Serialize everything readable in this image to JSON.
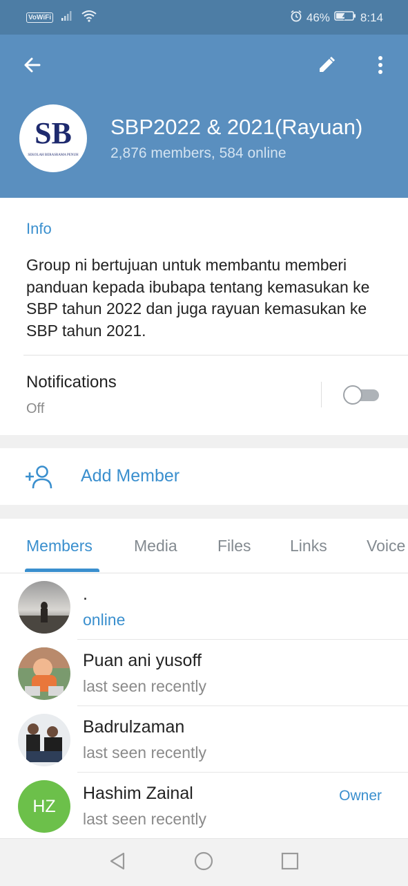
{
  "status_bar": {
    "vowifi": "VoWiFi",
    "battery": "46%",
    "time": "8:14"
  },
  "header": {
    "title": "SBP2022 & 2021(Rayuan)",
    "subtitle": "2,876 members, 584 online",
    "logo_text": "SB",
    "logo_caption": "SEKOLAH BERASRAMA PENUH",
    "bg_color": "#5a8fbf"
  },
  "info": {
    "label": "Info",
    "text": "Group ni bertujuan untuk membantu memberi panduan kepada ibubapa tentang kemasukan ke SBP tahun 2022 dan juga rayuan kemasukan ke SBP tahun 2021."
  },
  "notifications": {
    "title": "Notifications",
    "state": "Off"
  },
  "add_member": {
    "label": "Add Member"
  },
  "tabs": [
    {
      "label": "Members"
    },
    {
      "label": "Media"
    },
    {
      "label": "Files"
    },
    {
      "label": "Links"
    },
    {
      "label": "Voice"
    }
  ],
  "members": [
    {
      "name": ".",
      "status": "online"
    },
    {
      "name": "Puan ani yusoff",
      "status": "last seen recently"
    },
    {
      "name": "Badrulzaman",
      "status": "last seen recently"
    },
    {
      "name": "Hashim Zainal",
      "status": "last seen recently",
      "role": "Owner",
      "initials": "HZ",
      "avatar_color": "#6cc04a"
    }
  ],
  "accent_color": "#3a8fce"
}
